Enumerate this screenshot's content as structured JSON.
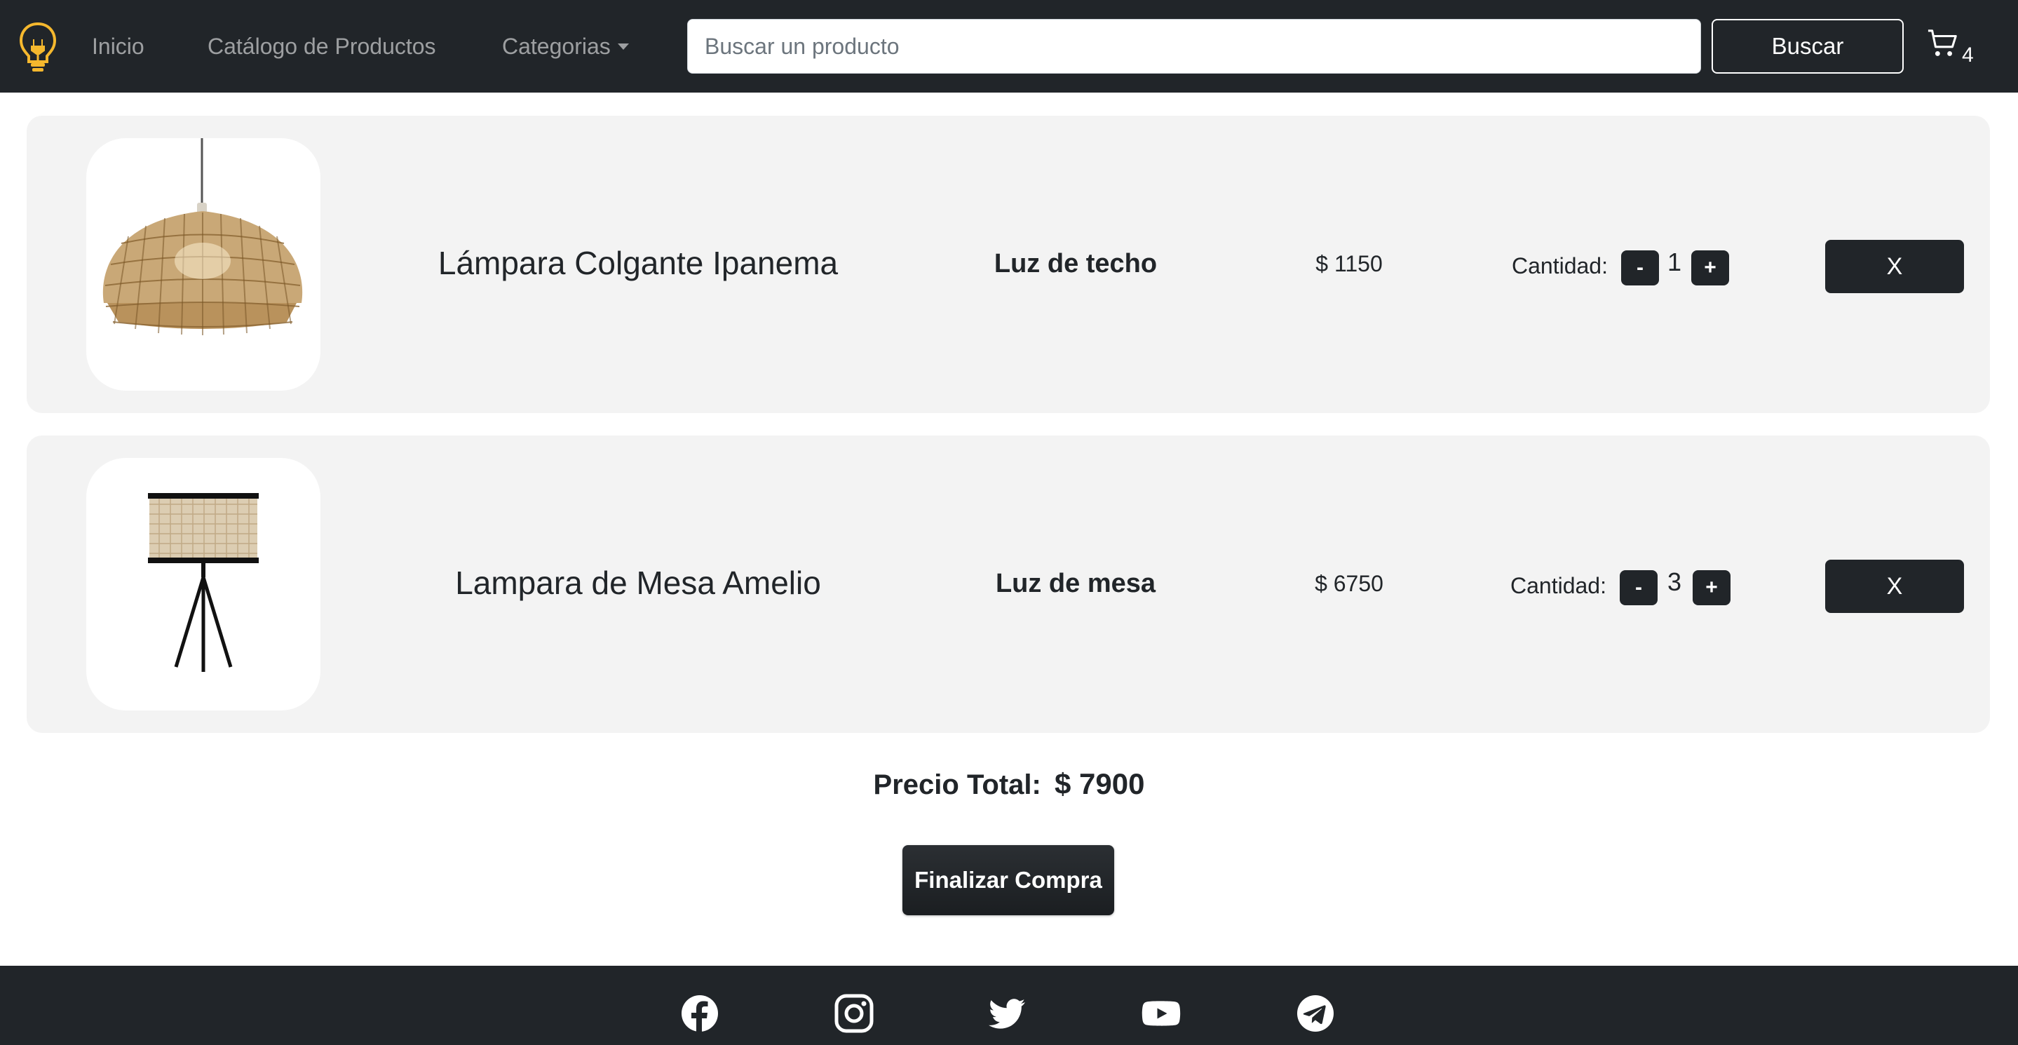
{
  "navbar": {
    "links": {
      "home": "Inicio",
      "catalog": "Catálogo de Productos",
      "categories": "Categorias"
    },
    "search": {
      "placeholder": "Buscar un producto",
      "value": "",
      "button_label": "Buscar"
    },
    "cart": {
      "icon": "cart-icon",
      "count": "4"
    },
    "logo_icon": "lightbulb-icon",
    "background": "#212529",
    "accent": "#f5b82e"
  },
  "cart_items": [
    {
      "name": "Lámpara Colgante Ipanema",
      "category": "Luz de techo",
      "price": "$ 1150",
      "quantity_label": "Cantidad:",
      "quantity": "1",
      "decrement_label": "-",
      "increment_label": "+",
      "remove_label": "X",
      "image": "rattan-pendant-lamp"
    },
    {
      "name": "Lampara de Mesa Amelio",
      "category": "Luz de mesa",
      "price": "$ 6750",
      "quantity_label": "Cantidad:",
      "quantity": "3",
      "decrement_label": "-",
      "increment_label": "+",
      "remove_label": "X",
      "image": "tripod-table-lamp"
    }
  ],
  "summary": {
    "total_label": "Precio Total:",
    "total_value": "$ 7900",
    "checkout_label": "Finalizar Compra"
  },
  "footer": {
    "social_icons": [
      "facebook-icon",
      "instagram-icon",
      "twitter-icon",
      "youtube-icon",
      "telegram-icon"
    ]
  }
}
